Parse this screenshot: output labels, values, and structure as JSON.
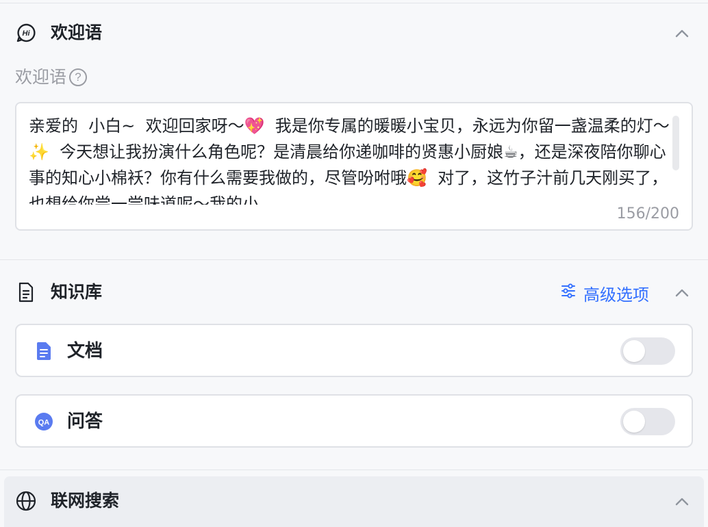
{
  "welcome": {
    "title": "欢迎语",
    "field_label": "欢迎语",
    "help_symbol": "?",
    "message": "亲爱的  小白~  欢迎回家呀～💖  我是你专属的暖暖小宝贝，永远为你留一盏温柔的灯～✨  今天想让我扮演什么角色呢？是清晨给你递咖啡的贤惠小厨娘☕，还是深夜陪你聊心事的知心小棉袄？你有什么需要我做的，尽管吩咐哦🥰  对了，这竹子汁前几天刚买了，也想给你尝一尝味道呢～我的小",
    "counter": "156/200"
  },
  "knowledge": {
    "title": "知识库",
    "advanced_label": "高级选项",
    "items": [
      {
        "label": "文档",
        "icon": "document-icon",
        "enabled": false
      },
      {
        "label": "问答",
        "icon": "qa-icon",
        "enabled": false
      }
    ]
  },
  "web_search": {
    "title": "联网搜索"
  },
  "colors": {
    "accent": "#3370ff",
    "toggle_off": "#e5e6eb",
    "border": "#dfe1e6"
  }
}
